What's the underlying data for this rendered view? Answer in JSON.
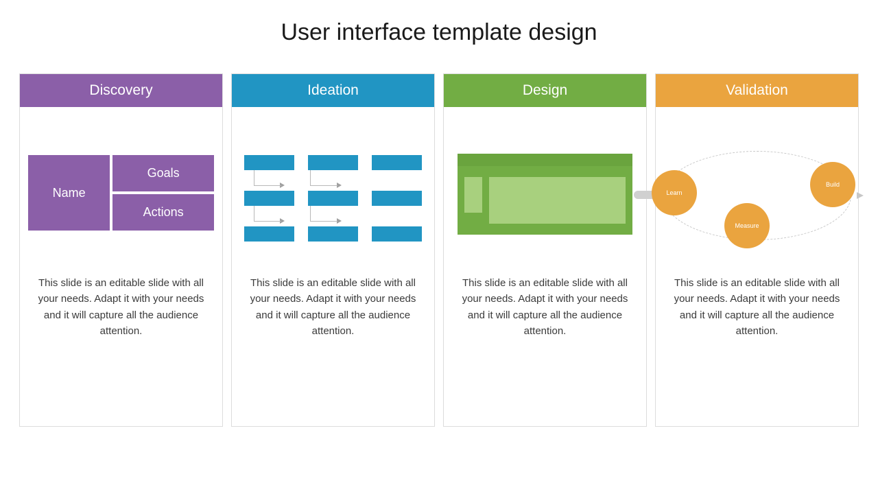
{
  "title": "User interface template design",
  "columns": [
    {
      "heading": "Discovery",
      "color": "#8b5fa8",
      "body": "This slide is an editable slide with all your needs. Adapt it with your needs and it will capture all the audience attention.",
      "labels": {
        "left": "Name",
        "top": "Goals",
        "bottom": "Actions"
      }
    },
    {
      "heading": "Ideation",
      "color": "#2195c3",
      "body": "This slide is an editable slide with all your needs. Adapt it with your needs and it will capture all the audience attention."
    },
    {
      "heading": "Design",
      "color": "#72ad44",
      "body": "This slide is an editable slide with all your needs. Adapt it with your needs and it will capture all the audience attention."
    },
    {
      "heading": "Validation",
      "color": "#eaa43f",
      "body": "This slide is an editable slide with all your needs. Adapt it with your needs and it will capture all the audience attention.",
      "labels": {
        "a": "Learn",
        "b": "Build",
        "c": "Measure"
      }
    }
  ]
}
